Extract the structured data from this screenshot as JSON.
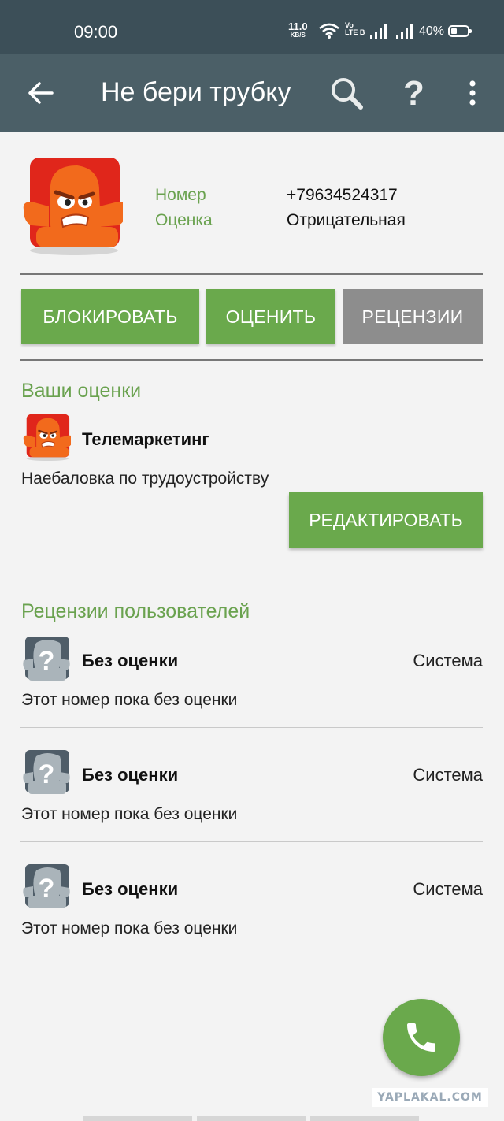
{
  "status_bar": {
    "time": "09:00",
    "speed_value": "11.0",
    "speed_unit": "KB/S",
    "volte_top": "Vo",
    "volte_bottom": "LTE B",
    "battery": "40%"
  },
  "app_bar": {
    "title": "Не бери трубку",
    "back_icon": "arrow-left-icon",
    "search_icon": "search-icon",
    "help_label": "?",
    "more_icon": "more-vert-icon"
  },
  "number_info": {
    "number_label": "Номер",
    "number_value": "+79634524317",
    "rating_label": "Оценка",
    "rating_value": "Отрицательная"
  },
  "actions": {
    "block": "БЛОКИРОВАТЬ",
    "rate": "ОЦЕНИТЬ",
    "reviews": "РЕЦЕНЗИИ"
  },
  "my_ratings": {
    "title": "Ваши оценки",
    "category": "Телемаркетинг",
    "comment": "Наебаловка по трудоустройству",
    "edit_button": "РЕДАКТИРОВАТЬ"
  },
  "user_reviews": {
    "title": "Рецензии пользователей",
    "items": [
      {
        "label": "Без оценки",
        "source": "Система",
        "text": "Этот номер пока без оценки"
      },
      {
        "label": "Без оценки",
        "source": "Система",
        "text": "Этот номер пока без оценки"
      },
      {
        "label": "Без оценки",
        "source": "Система",
        "text": "Этот номер пока без оценки"
      }
    ]
  },
  "fab_icon": "phone-icon",
  "watermark": "YAPLAKAL.COM",
  "colors": {
    "status_bar": "#3c4f58",
    "app_bar": "#4b5f67",
    "accent_green": "#6aa94c",
    "button_gray": "#8d8d8d",
    "avatar_red": "#e0261b",
    "avatar_orange": "#f26a1c",
    "avatar_unknown": "#4f5d68"
  }
}
